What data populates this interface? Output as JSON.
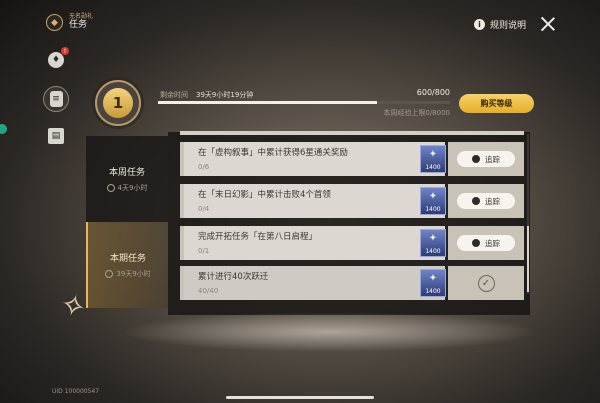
{
  "header": {
    "brand_sub": "无名勋礼",
    "brand_title": "任务",
    "rules_label": "规则说明",
    "info_icon": "i"
  },
  "side_tabs": [
    {
      "icon": "reward-icon",
      "badge": "!"
    },
    {
      "icon": "mission-clipboard-icon"
    },
    {
      "icon": "shop-icon"
    }
  ],
  "level": {
    "value": "1",
    "time_label": "剩余时间",
    "time_value": "39天9小时19分钟",
    "xp": "600/800",
    "xp_progress": 0.75,
    "weekly_cap": "本周经验上限0/8000",
    "buy_label": "购买等级"
  },
  "categories": [
    {
      "name": "本周任务",
      "time": "4天9小时"
    },
    {
      "name": "本期任务",
      "time": "39天9小时"
    }
  ],
  "missions": [
    {
      "title": "在「虚构叙事」中累计获得6星通关奖励",
      "progress": "0/6",
      "reward": "1400",
      "action": "追踪"
    },
    {
      "title": "在「末日幻影」中累计击败4个首领",
      "progress": "0/4",
      "reward": "1400",
      "action": "追踪"
    },
    {
      "title": "完成开拓任务「在第八日启程」",
      "progress": "0/1",
      "reward": "1400",
      "action": "追踪"
    },
    {
      "title": "累计进行40次跃迁",
      "progress": "40/40",
      "reward": "1400",
      "action": "completed"
    }
  ],
  "version": "UID 100000547"
}
